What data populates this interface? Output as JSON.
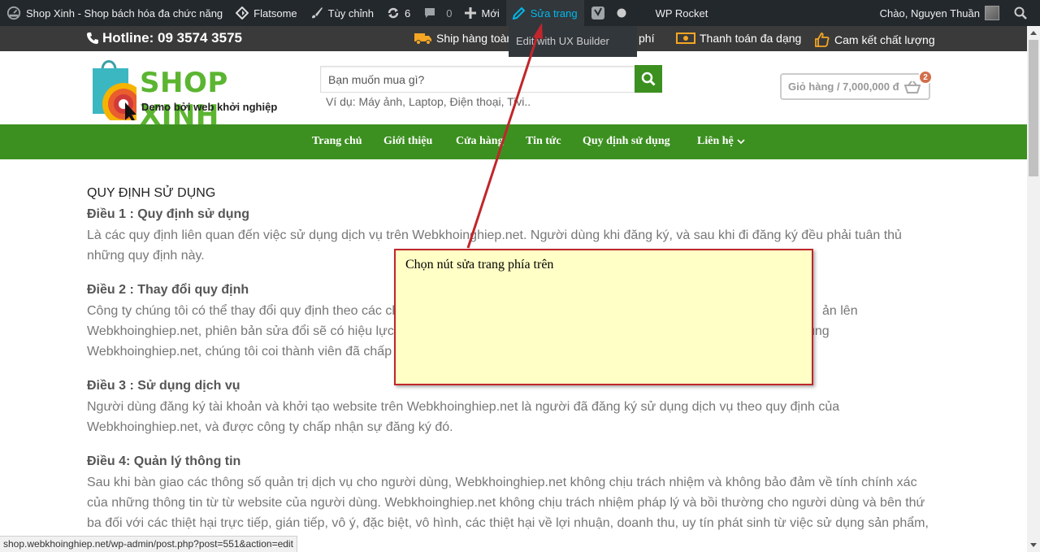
{
  "adminbar": {
    "site_name": "Shop Xinh - Shop bách hóa đa chức năng",
    "theme": "Flatsome",
    "customize": "Tùy chỉnh",
    "updates_count": "6",
    "comments_count": "0",
    "new": "Mới",
    "edit_page": "Sửa trang",
    "wp_rocket": "WP Rocket",
    "greeting": "Chào, Nguyen Thuần",
    "dropdown_item": "Edit with UX Builder"
  },
  "topbar": {
    "hotline": "Hotline: 09 3574 3575",
    "ship": "Ship hàng toàn",
    "ship_tail": "phí",
    "payment": "Thanh toán đa dạng",
    "quality": "Cam kết chất lượng"
  },
  "header": {
    "logo_title": "SHOP XINH",
    "logo_sub": "Demo bởi web khởi nghiệp",
    "search_placeholder": "Bạn muốn mua gì?",
    "search_hint": "Ví dụ: Máy ảnh, Laptop, Điện thoại, Tivi..",
    "cart_label": "Giỏ hàng / 7,000,000 đ",
    "cart_count": "2"
  },
  "nav": {
    "items": [
      "Trang chủ",
      "Giới thiệu",
      "Cửa hàng",
      "Tin tức",
      "Quy định sử dụng",
      "Liên hệ"
    ]
  },
  "content": {
    "title": "QUY ĐỊNH SỬ DỤNG",
    "sections": [
      {
        "heading": "Điều 1 : Quy định sử dụng",
        "lines": [
          "Là các quy định liên quan đến việc sử dụng dịch vụ trên Webkhoinghiep.net. Người dùng khi đăng ký, và sau khi đi đăng ký đều phải tuân thủ",
          "những quy định này."
        ]
      },
      {
        "heading": "Điều 2 : Thay đổi quy định",
        "lines": [
          "Công ty chúng tôi có thể thay đổi quy định theo các ch",
          "Webkhoinghiep.net, phiên bản sửa đổi sẽ có hiệu lực",
          "Webkhoinghiep.net, chúng tôi coi thành viên đã chấp"
        ],
        "right": [
          "ản lên",
          "ung"
        ]
      },
      {
        "heading": "Điều 3 : Sử dụng dịch vụ",
        "lines": [
          "Người dùng đăng ký tài khoản và khởi tạo website trên Webkhoinghiep.net là người đã đăng ký sử dụng dịch vụ theo quy định của",
          "Webkhoinghiep.net, và được công ty chấp nhận sự đăng ký đó."
        ]
      },
      {
        "heading": "Điều 4: Quản lý thông tin",
        "lines": [
          "Sau khi bàn giao các thông số quản trị dịch vụ cho người dùng, Webkhoinghiep.net không chịu trách nhiệm và không bảo đảm về tính chính xác",
          "của những thông tin từ từ website của người dùng. Webkhoinghiep.net không chịu trách nhiệm pháp lý và bồi thường cho người dùng và bên thứ",
          "ba đối với các thiệt hại trực tiếp, gián tiếp, vô ý, đặc biệt, vô hình, các thiệt hại về lợi nhuận, doanh thu, uy tín phát sinh từ việc sử dụng sản phẩm,"
        ]
      }
    ]
  },
  "callout": {
    "text": "Chọn nút sửa trang phía trên"
  },
  "statusbar": {
    "url": "shop.webkhoinghiep.net/wp-admin/post.php?post=551&action=edit"
  },
  "colors": {
    "adminbar": "#23282d",
    "brand_green": "#3c9020",
    "callout_bg": "#ffffc6",
    "callout_border": "#c0262b",
    "active_link": "#00b9eb"
  }
}
